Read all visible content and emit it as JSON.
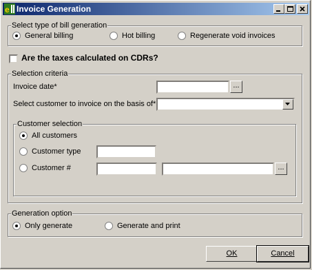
{
  "window": {
    "title": "Invoice Generation"
  },
  "bill_type": {
    "label": "Select type of bill generation",
    "options": [
      "General billing",
      "Hot billing",
      "Regenerate void invoices"
    ],
    "selected": "General billing"
  },
  "taxes": {
    "label": "Are the taxes calculated on CDRs?",
    "checked": false
  },
  "selection": {
    "label": "Selection criteria",
    "invoice_date_label": "Invoice date*",
    "invoice_date_value": "",
    "ellipsis": "...",
    "customer_basis_label": "Select customer to invoice on the basis of*",
    "customer_basis_value": ""
  },
  "customer_selection": {
    "label": "Customer selection",
    "all": "All customers",
    "type": "Customer type",
    "number": "Customer #",
    "selected": "All customers",
    "type_value": "",
    "number_value": "",
    "name_value": ""
  },
  "generation": {
    "label": "Generation option",
    "only": "Only generate",
    "print": "Generate and print",
    "selected": "Only generate"
  },
  "buttons": {
    "ok": "OK",
    "cancel": "Cancel"
  },
  "colors": {
    "titlebar_start": "#0a246a",
    "titlebar_end": "#a6caf0",
    "face": "#d4d0c8"
  }
}
